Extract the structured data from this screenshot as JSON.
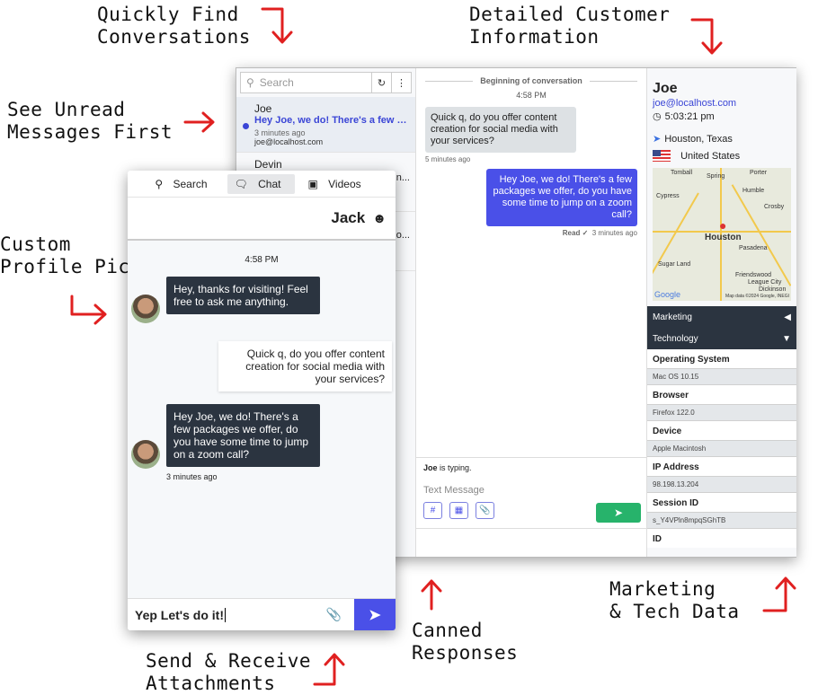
{
  "annotations": {
    "find": "Quickly Find\nConversations",
    "detail": "Detailed Customer\nInformation",
    "unread": "See Unread\nMessages First",
    "profile": "Custom\nProfile Pic",
    "canned": "Canned\nResponses",
    "attach": "Send & Receive\nAttachments",
    "marketing": "Marketing\n& Tech Data"
  },
  "accent_color": "#4a50e8",
  "annotation_color": "#e02020",
  "list": {
    "search_placeholder": "Search",
    "refresh_icon": "refresh-icon",
    "menu_icon": "kebab-icon",
    "conversations": [
      {
        "name": "Joe",
        "preview": "Hey Joe, we do! There's a few packag...",
        "time": "3 minutes ago",
        "email": "joe@localhost.com",
        "unread": true
      },
      {
        "name": "Devin",
        "preview": "n..."
      },
      {
        "preview": "o..."
      }
    ]
  },
  "conversation": {
    "beginning": "Beginning of conversation",
    "time": "4:58 PM",
    "messages": [
      {
        "text": "Quick q, do you offer content creation for social media with your services?",
        "meta": "5 minutes ago",
        "dir": "in"
      },
      {
        "text": "Hey Joe, we do! There's a few packages we offer, do you have some time to jump on a zoom call?",
        "read": "Read ✓",
        "meta": "3 minutes ago",
        "dir": "out"
      }
    ],
    "typing_name": "Joe",
    "typing_text": " is typing.",
    "input_placeholder": "Text Message"
  },
  "customer": {
    "name": "Joe",
    "email": "joe@localhost.com",
    "local_time": "5:03:21 pm",
    "location": "Houston, Texas",
    "country": "United States",
    "map": {
      "city": "Houston",
      "places": [
        "Tomball",
        "Spring",
        "Porter",
        "Humble",
        "Cypress",
        "Crosby",
        "Pasadena",
        "Sugar Land",
        "Friendswood",
        "League City",
        "Dickinson"
      ],
      "attribution": "Map data ©2024 Google, INEGI",
      "logo": "Google"
    },
    "sections": [
      {
        "label": "Marketing",
        "state": "collapsed"
      },
      {
        "label": "Technology",
        "state": "expanded"
      }
    ],
    "tech": [
      {
        "k": "Operating System",
        "v": "Mac OS 10.15"
      },
      {
        "k": "Browser",
        "v": "Firefox 122.0"
      },
      {
        "k": "Device",
        "v": "Apple Macintosh"
      },
      {
        "k": "IP Address",
        "v": "98.198.13.204"
      },
      {
        "k": "Session ID",
        "v": "s_Y4VPln8mpqSGhTB"
      },
      {
        "k": "ID",
        "v": ""
      }
    ]
  },
  "widget": {
    "tabs": [
      "Search",
      "Chat",
      "Videos"
    ],
    "active_tab": "Chat",
    "agent": "Jack",
    "time": "4:58 PM",
    "messages": [
      {
        "text": "Hey, thanks for visiting! Feel free to ask me anything.",
        "dir": "in"
      },
      {
        "text": "Quick q, do you offer content creation for social media with your services?",
        "dir": "out"
      },
      {
        "text": "Hey Joe, we do! There's a few packages we offer, do you have some time to jump on a zoom call?",
        "dir": "in",
        "meta": "3 minutes ago"
      }
    ],
    "input_value": "Yep Let's do it!"
  }
}
